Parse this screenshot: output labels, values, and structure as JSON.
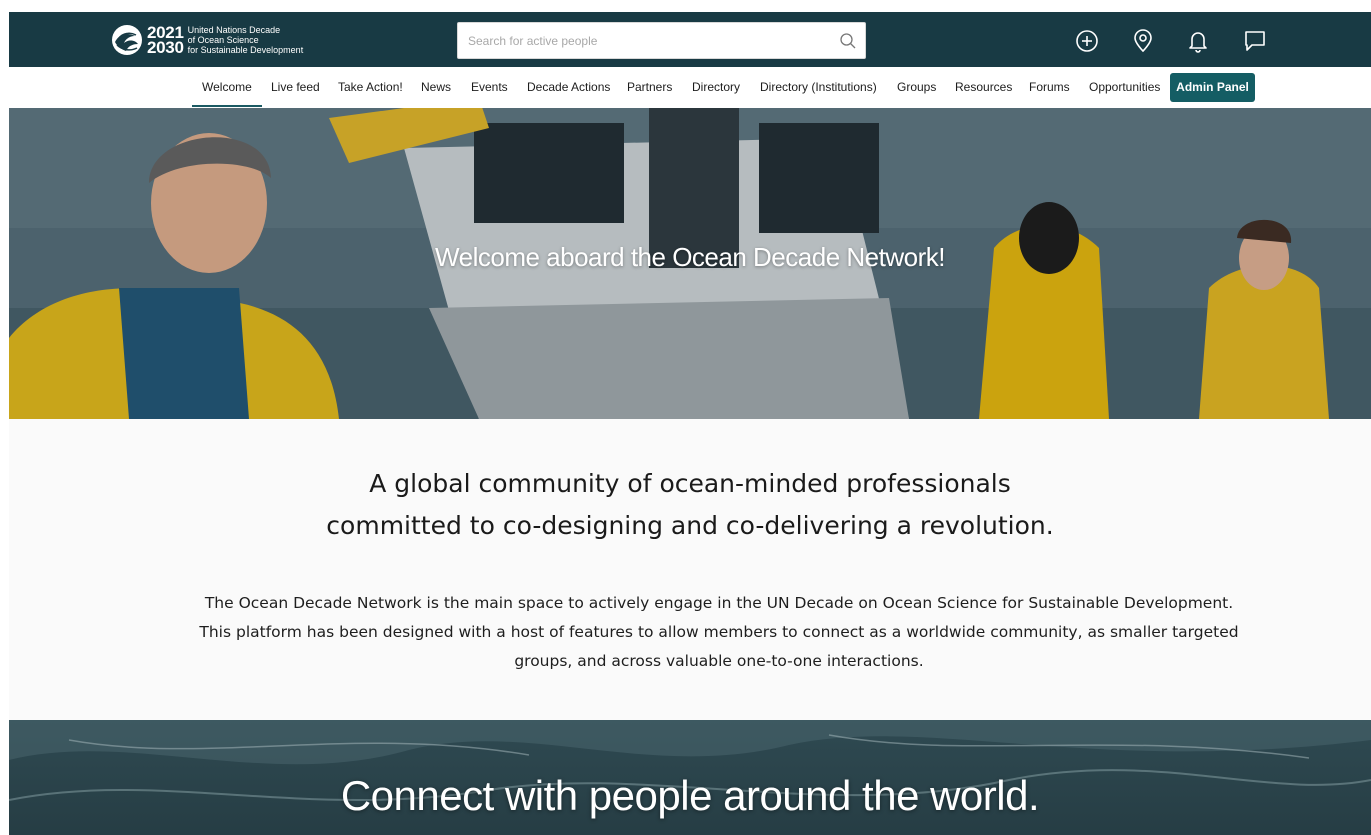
{
  "header": {
    "logo": {
      "year_top": "2021",
      "year_bottom": "2030",
      "line1": "United Nations Decade",
      "line2": "of Ocean Science",
      "line3": "for Sustainable Development"
    },
    "search": {
      "placeholder": "Search for active people",
      "value": ""
    },
    "icons": [
      "add-circle-icon",
      "location-pin-icon",
      "bell-icon",
      "chat-bubble-icon"
    ]
  },
  "nav": {
    "items": [
      {
        "label": "Welcome",
        "active": true
      },
      {
        "label": "Live feed"
      },
      {
        "label": "Take Action!"
      },
      {
        "label": "News"
      },
      {
        "label": "Events"
      },
      {
        "label": "Decade Actions"
      },
      {
        "label": "Partners"
      },
      {
        "label": "Directory"
      },
      {
        "label": "Directory (Institutions)"
      },
      {
        "label": "Groups"
      },
      {
        "label": "Resources"
      },
      {
        "label": "Forums"
      },
      {
        "label": "Opportunities"
      }
    ],
    "admin_button": "Admin Panel"
  },
  "hero": {
    "title": "Welcome aboard the Ocean Decade Network!"
  },
  "intro": {
    "tagline_line1": "A global community of ocean-minded professionals",
    "tagline_line2": "committed to co-designing and co-delivering a revolution.",
    "description": "The Ocean Decade Network is the main space to actively engage in the UN Decade on Ocean Science for Sustainable Development. This platform has been designed with a host of features to allow members to connect as a worldwide community, as smaller targeted groups, and across valuable one-to-one interactions."
  },
  "band": {
    "title": "Connect with people around the world."
  },
  "colors": {
    "header_bg": "#183a44",
    "accent": "#145d64",
    "intro_bg": "#fafafa"
  }
}
